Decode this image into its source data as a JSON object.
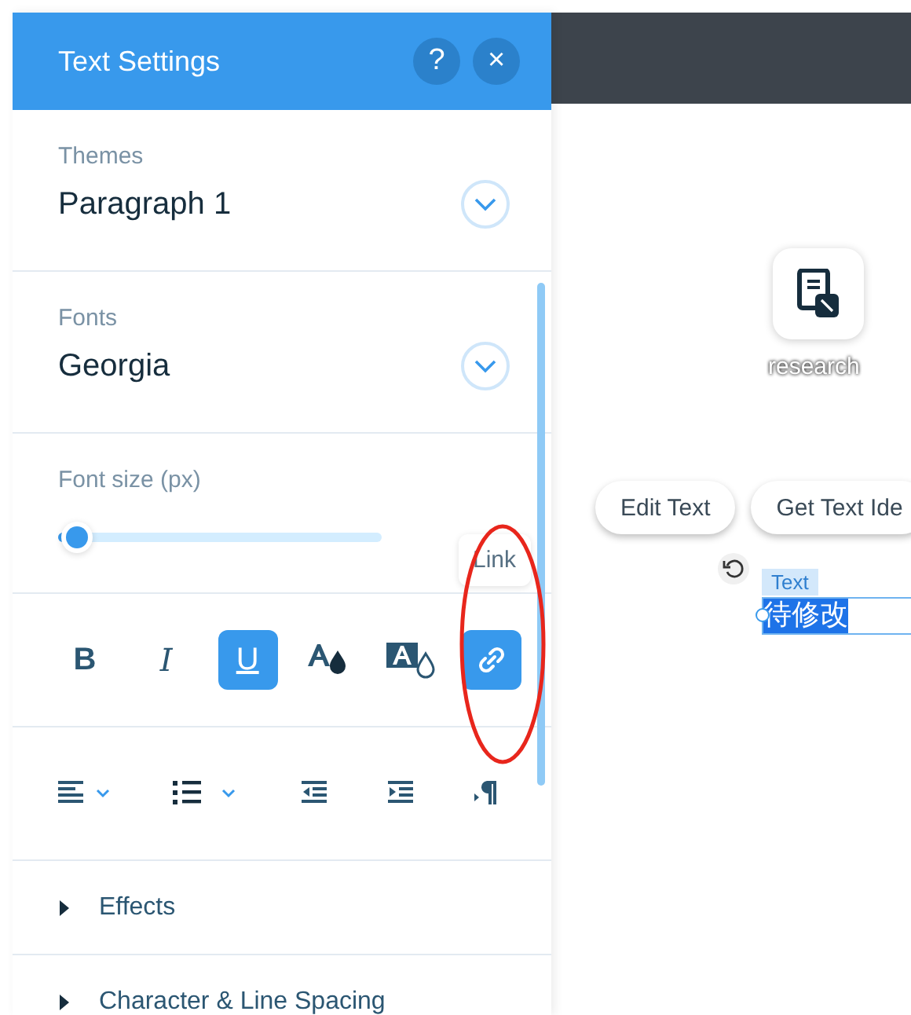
{
  "panel": {
    "title": "Text Settings",
    "help_label": "?",
    "close_label": "×"
  },
  "themes": {
    "label": "Themes",
    "value": "Paragraph 1"
  },
  "fonts": {
    "label": "Fonts",
    "value": "Georgia"
  },
  "font_size": {
    "label": "Font size (px)",
    "level": 0.06
  },
  "format_buttons": [
    {
      "kind": "bold",
      "label": "B",
      "selected": false
    },
    {
      "kind": "italic",
      "label": "I",
      "selected": false
    },
    {
      "kind": "underline",
      "label": "U",
      "selected": true
    },
    {
      "kind": "text-color",
      "selected": false
    },
    {
      "kind": "highlight",
      "selected": false
    },
    {
      "kind": "link",
      "selected": true
    }
  ],
  "tooltip": "Link",
  "paragraph_buttons": [
    {
      "kind": "align"
    },
    {
      "kind": "list"
    },
    {
      "kind": "outdent"
    },
    {
      "kind": "indent"
    },
    {
      "kind": "direction"
    }
  ],
  "sections": [
    {
      "label": "Effects",
      "expanded": false
    },
    {
      "label": "Character & Line Spacing",
      "expanded": false
    }
  ],
  "canvas": {
    "app_label": "research",
    "buttons": [
      "Edit Text",
      "Get Text Ide"
    ],
    "element_tag": "Text",
    "selected_text": "待修改"
  }
}
